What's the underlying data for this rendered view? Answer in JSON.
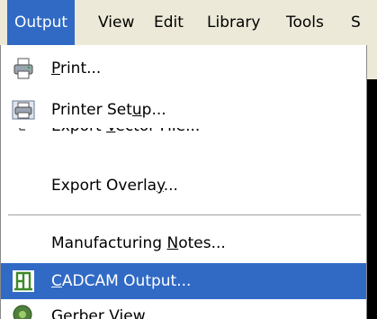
{
  "menubar": {
    "items": [
      {
        "label": "Output",
        "active": true
      },
      {
        "label": "View"
      },
      {
        "label": "Edit"
      },
      {
        "label": "Library"
      },
      {
        "label": "Tools"
      },
      {
        "label": "S"
      }
    ]
  },
  "menu": {
    "print": {
      "pre": "",
      "u": "P",
      "post": "rint...",
      "icon": "printer-icon"
    },
    "setup": {
      "pre": "Printer Set",
      "u": "u",
      "post": "p...",
      "icon": "printer-setup-icon"
    },
    "vector": {
      "pre": "Export ",
      "u": "V",
      "post": "ector File...",
      "icon": "export-vector-icon"
    },
    "overlay": {
      "pre": "Export Overla",
      "u": "y",
      "post": "...",
      "icon": ""
    },
    "notes": {
      "pre": "Manufacturing ",
      "u": "N",
      "post": "otes...",
      "icon": ""
    },
    "cadcam": {
      "pre": "",
      "u": "C",
      "post": "ADCAM Output...",
      "icon": "cadcam-icon"
    },
    "gerber": {
      "pre": "Gerber View",
      "u": "",
      "post": "",
      "icon": "gerber-view-icon"
    }
  },
  "colors": {
    "highlight": "#316ac5",
    "menubar_bg": "#ece9d8"
  }
}
